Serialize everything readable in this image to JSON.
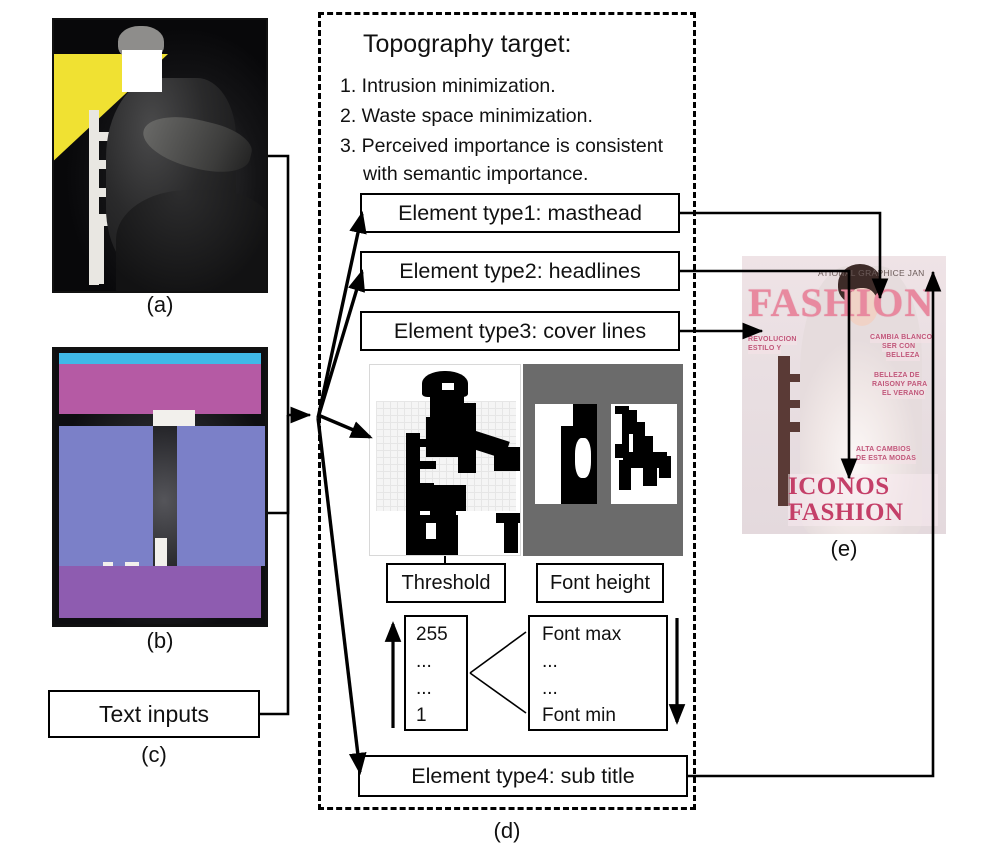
{
  "figure": {
    "captions": {
      "a": "(a)",
      "b": "(b)",
      "c": "(c)",
      "d": "(d)",
      "e": "(e)"
    }
  },
  "topography": {
    "title": "Topography target:",
    "items": [
      "1. Intrusion minimization.",
      "2. Waste space minimization.",
      "3. Perceived importance is consistent",
      "with semantic importance."
    ]
  },
  "element_types": [
    {
      "label": "Element type1: masthead"
    },
    {
      "label": "Element type2: headlines"
    },
    {
      "label": "Element type3: cover lines"
    },
    {
      "label": "Element type4: sub title"
    }
  ],
  "process_boxes": {
    "threshold_label": "Threshold",
    "font_height_label": "Font height"
  },
  "threshold_values": [
    "255",
    "...",
    "...",
    "1"
  ],
  "font_values": [
    "Font max",
    "...",
    "...",
    "Font min"
  ],
  "text_inputs": {
    "label": "Text inputs"
  },
  "magazine_cover": {
    "top_line": "ATIONAL GRAPHICE JAN",
    "masthead": "FASHION",
    "cover_lines_left": [
      "REVOLUCION",
      "ESTILO Y"
    ],
    "cover_lines_right_1": [
      "CAMBIA BLANCO",
      "SER CON",
      "BELLEZA"
    ],
    "cover_lines_right_2": [
      "BELLEZA DE",
      "RAISONY PARA",
      "EL VERANO"
    ],
    "cover_lines_mid": [
      "ALTA CAMBIOS",
      "DE ESTA MODAS"
    ],
    "sub_title": [
      "ICONOS",
      "FASHION"
    ]
  },
  "colors": {
    "magenta_band": "#b55aa4",
    "cyan_strip": "#3fb8e8",
    "blue_block": "#7b80c8",
    "purple_band": "#8e5cb0",
    "yellow_triangle": "#f0e132",
    "cover_pink": "#e8899f",
    "cover_accent": "#c43f68"
  }
}
